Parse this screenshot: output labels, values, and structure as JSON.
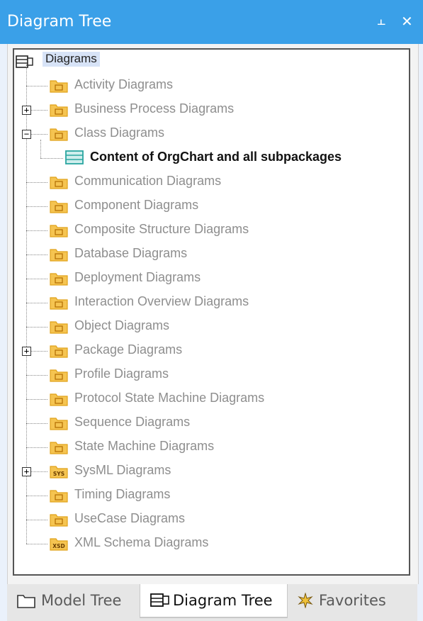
{
  "window": {
    "title": "Diagram Tree",
    "pin_glyph": "⫠",
    "close_glyph": "✕"
  },
  "tree": {
    "root": {
      "label": "Diagrams",
      "icon": "diagram-tree-icon"
    },
    "items": [
      {
        "label": "Activity Diagrams",
        "icon": "activity-folder-icon",
        "expander": null
      },
      {
        "label": "Business Process Diagrams",
        "icon": "business-process-folder-icon",
        "expander": "+"
      },
      {
        "label": "Class Diagrams",
        "icon": "class-folder-icon",
        "expander": "−"
      },
      {
        "label": "Content of OrgChart and all subpackages",
        "icon": "class-diagram-icon",
        "expander": null,
        "child": true
      },
      {
        "label": "Communication Diagrams",
        "icon": "communication-folder-icon",
        "expander": null
      },
      {
        "label": "Component Diagrams",
        "icon": "component-folder-icon",
        "expander": null
      },
      {
        "label": "Composite Structure Diagrams",
        "icon": "composite-structure-folder-icon",
        "expander": null
      },
      {
        "label": "Database Diagrams",
        "icon": "database-folder-icon",
        "expander": null
      },
      {
        "label": "Deployment Diagrams",
        "icon": "deployment-folder-icon",
        "expander": null
      },
      {
        "label": "Interaction Overview Diagrams",
        "icon": "interaction-overview-folder-icon",
        "expander": null
      },
      {
        "label": "Object Diagrams",
        "icon": "object-folder-icon",
        "expander": null
      },
      {
        "label": "Package Diagrams",
        "icon": "package-folder-icon",
        "expander": "+"
      },
      {
        "label": "Profile Diagrams",
        "icon": "profile-folder-icon",
        "expander": null
      },
      {
        "label": "Protocol State Machine Diagrams",
        "icon": "protocol-state-machine-folder-icon",
        "expander": null
      },
      {
        "label": "Sequence Diagrams",
        "icon": "sequence-folder-icon",
        "expander": null
      },
      {
        "label": "State Machine Diagrams",
        "icon": "state-machine-folder-icon",
        "expander": null
      },
      {
        "label": "SysML Diagrams",
        "icon": "sysml-folder-icon",
        "expander": "+",
        "badge": "SYS"
      },
      {
        "label": "Timing Diagrams",
        "icon": "timing-folder-icon",
        "expander": null
      },
      {
        "label": "UseCase Diagrams",
        "icon": "usecase-folder-icon",
        "expander": null
      },
      {
        "label": "XML Schema Diagrams",
        "icon": "xml-schema-folder-icon",
        "expander": null,
        "badge": "XSD"
      }
    ]
  },
  "tabs": [
    {
      "label": "Model Tree",
      "icon": "model-tree-icon",
      "active": false
    },
    {
      "label": "Diagram Tree",
      "icon": "diagram-tree-tab-icon",
      "active": true
    },
    {
      "label": "Favorites",
      "icon": "favorites-icon",
      "active": false
    }
  ],
  "colors": {
    "titlebar": "#3aa0e8",
    "folder": "#f5c451",
    "folder_dark": "#e0a21b",
    "selection": "#d7e3f7",
    "diagram_icon": "#2aa6a0"
  }
}
